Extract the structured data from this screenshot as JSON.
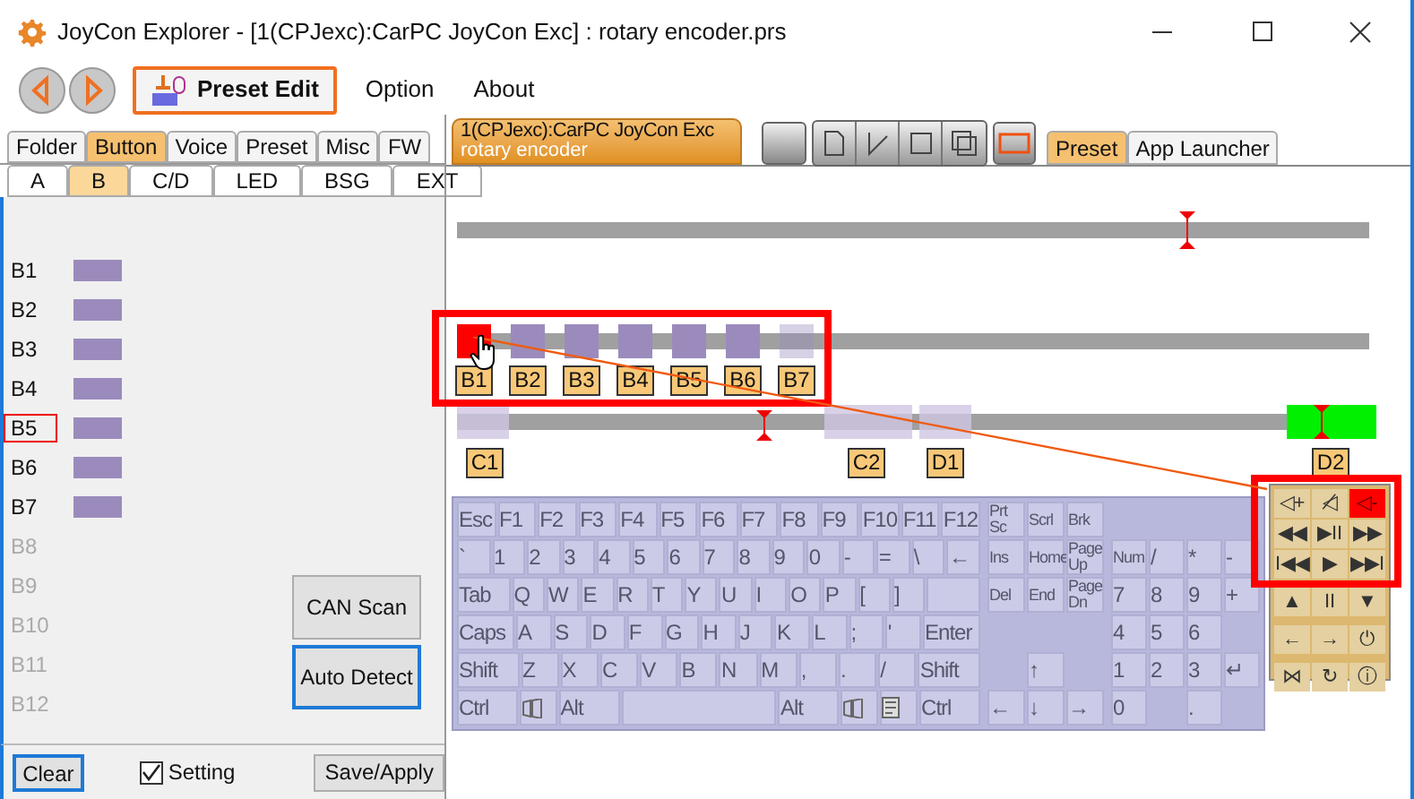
{
  "window": {
    "title": "JoyCon Explorer - [1(CPJexc):CarPC JoyCon Exc] : rotary encoder.prs"
  },
  "menu": [
    {
      "label": "Preset Edit",
      "selected": true
    },
    {
      "label": "Option",
      "selected": false
    },
    {
      "label": "About",
      "selected": false
    }
  ],
  "main_tabs": [
    {
      "label": "Folder",
      "selected": false
    },
    {
      "label": "Button",
      "selected": true
    },
    {
      "label": "Voice",
      "selected": false
    },
    {
      "label": "Preset",
      "selected": false
    },
    {
      "label": "Misc",
      "selected": false
    },
    {
      "label": "FW",
      "selected": false
    }
  ],
  "sub_tabs": [
    {
      "label": "A",
      "selected": false
    },
    {
      "label": "B",
      "selected": true
    },
    {
      "label": "C/D",
      "selected": false
    },
    {
      "label": "LED",
      "selected": false
    },
    {
      "label": "BSG",
      "selected": false
    },
    {
      "label": "EXT",
      "selected": false
    }
  ],
  "button_list": [
    {
      "label": "B1",
      "assigned": true,
      "selected": false
    },
    {
      "label": "B2",
      "assigned": true,
      "selected": false
    },
    {
      "label": "B3",
      "assigned": true,
      "selected": false
    },
    {
      "label": "B4",
      "assigned": true,
      "selected": false
    },
    {
      "label": "B5",
      "assigned": true,
      "selected": true
    },
    {
      "label": "B6",
      "assigned": true,
      "selected": false
    },
    {
      "label": "B7",
      "assigned": true,
      "selected": false
    },
    {
      "label": "B8",
      "assigned": false,
      "selected": false
    },
    {
      "label": "B9",
      "assigned": false,
      "selected": false
    },
    {
      "label": "B10",
      "assigned": false,
      "selected": false
    },
    {
      "label": "B11",
      "assigned": false,
      "selected": false
    },
    {
      "label": "B12",
      "assigned": false,
      "selected": false
    }
  ],
  "actions": [
    {
      "label": "CAN Scan",
      "focused": false
    },
    {
      "label": "Auto Detect",
      "focused": true
    }
  ],
  "footer": {
    "clear": {
      "label": "Clear",
      "focused": true
    },
    "setting": {
      "label": "Setting",
      "checked": true
    },
    "save": "Save/Apply"
  },
  "device_tab": {
    "title": "1(CPJexc):CarPC JoyCon Exc",
    "subtitle": "rotary encoder"
  },
  "panel_tabs": [
    {
      "label": "Preset",
      "selected": true
    },
    {
      "label": "App Launcher",
      "selected": false
    }
  ],
  "timeline": {
    "buttons": [
      {
        "label": "B1",
        "selected": true,
        "dimmed": false
      },
      {
        "label": "B2",
        "selected": false,
        "dimmed": false
      },
      {
        "label": "B3",
        "selected": false,
        "dimmed": false
      },
      {
        "label": "B4",
        "selected": false,
        "dimmed": false
      },
      {
        "label": "B5",
        "selected": false,
        "dimmed": false
      },
      {
        "label": "B6",
        "selected": false,
        "dimmed": false
      },
      {
        "label": "B7",
        "selected": false,
        "dimmed": true
      }
    ],
    "ranges": [
      {
        "label": "C1",
        "active": false
      },
      {
        "label": "C2",
        "active": false
      },
      {
        "label": "D1",
        "active": false
      },
      {
        "label": "D2",
        "active": true
      }
    ]
  },
  "keyboard": {
    "main": [
      [
        {
          "kind": "key",
          "label": "Esc"
        },
        {
          "kind": "key",
          "label": "F1"
        },
        {
          "kind": "key",
          "label": "F2"
        },
        {
          "kind": "key",
          "label": "F3"
        },
        {
          "kind": "key",
          "label": "F4"
        },
        {
          "kind": "key",
          "label": "F5"
        },
        {
          "kind": "key",
          "label": "F6"
        },
        {
          "kind": "key",
          "label": "F7"
        },
        {
          "kind": "key",
          "label": "F8"
        },
        {
          "kind": "key",
          "label": "F9"
        },
        {
          "kind": "key",
          "label": "F10"
        },
        {
          "kind": "key",
          "label": "F11"
        },
        {
          "kind": "key",
          "label": "F12"
        }
      ],
      [
        {
          "kind": "key",
          "label": "`"
        },
        {
          "kind": "key",
          "label": "1"
        },
        {
          "kind": "key",
          "label": "2"
        },
        {
          "kind": "key",
          "label": "3"
        },
        {
          "kind": "key",
          "label": "4"
        },
        {
          "kind": "key",
          "label": "5"
        },
        {
          "kind": "key",
          "label": "6"
        },
        {
          "kind": "key",
          "label": "7"
        },
        {
          "kind": "key",
          "label": "8"
        },
        {
          "kind": "key",
          "label": "9"
        },
        {
          "kind": "key",
          "label": "0"
        },
        {
          "kind": "key",
          "label": "-"
        },
        {
          "kind": "key",
          "label": "="
        },
        {
          "kind": "key",
          "label": "\\"
        },
        {
          "kind": "key",
          "label": "←"
        }
      ],
      [
        {
          "kind": "wide",
          "label": "Tab"
        },
        {
          "kind": "key",
          "label": "Q"
        },
        {
          "kind": "key",
          "label": "W"
        },
        {
          "kind": "key",
          "label": "E"
        },
        {
          "kind": "key",
          "label": "R"
        },
        {
          "kind": "key",
          "label": "T"
        },
        {
          "kind": "key",
          "label": "Y"
        },
        {
          "kind": "key",
          "label": "U"
        },
        {
          "kind": "key",
          "label": "I"
        },
        {
          "kind": "key",
          "label": "O"
        },
        {
          "kind": "key",
          "label": "P"
        },
        {
          "kind": "key",
          "label": "["
        },
        {
          "kind": "key",
          "label": "]"
        },
        {
          "kind": "blank"
        }
      ],
      [
        {
          "kind": "wide",
          "label": "Caps"
        },
        {
          "kind": "key",
          "label": "A"
        },
        {
          "kind": "key",
          "label": "S"
        },
        {
          "kind": "key",
          "label": "D"
        },
        {
          "kind": "key",
          "label": "F"
        },
        {
          "kind": "key",
          "label": "G"
        },
        {
          "kind": "key",
          "label": "H"
        },
        {
          "kind": "key",
          "label": "J"
        },
        {
          "kind": "key",
          "label": "K"
        },
        {
          "kind": "key",
          "label": "L"
        },
        {
          "kind": "key",
          "label": ";"
        },
        {
          "kind": "key",
          "label": "'"
        },
        {
          "kind": "wide",
          "label": "Enter"
        }
      ],
      [
        {
          "kind": "wide",
          "label": "Shift"
        },
        {
          "kind": "key",
          "label": "Z"
        },
        {
          "kind": "key",
          "label": "X"
        },
        {
          "kind": "key",
          "label": "C"
        },
        {
          "kind": "key",
          "label": "V"
        },
        {
          "kind": "key",
          "label": "B"
        },
        {
          "kind": "key",
          "label": "N"
        },
        {
          "kind": "key",
          "label": "M"
        },
        {
          "kind": "key",
          "label": ","
        },
        {
          "kind": "key",
          "label": "."
        },
        {
          "kind": "key",
          "label": "/"
        },
        {
          "kind": "wide",
          "label": "Shift"
        }
      ],
      [
        {
          "kind": "wide",
          "label": "Ctrl"
        },
        {
          "kind": "logo"
        },
        {
          "kind": "wide",
          "label": "Alt"
        },
        {
          "kind": "space"
        },
        {
          "kind": "wide",
          "label": "Alt"
        },
        {
          "kind": "logo"
        },
        {
          "kind": "menu"
        },
        {
          "kind": "wide",
          "label": "Ctrl"
        }
      ]
    ],
    "nav": [
      "Prt Sc",
      "Scrl",
      "Brk",
      "Ins",
      "Home",
      "Page Up",
      "Del",
      "End",
      "Page Dn",
      "↑",
      "←",
      "↓",
      "→"
    ],
    "numpad": [
      "Num",
      "/",
      "*",
      "-",
      "7",
      "8",
      "9",
      "+",
      "4",
      "5",
      "6",
      "1",
      "2",
      "3",
      "↵",
      "0",
      "."
    ]
  },
  "media_buttons": [
    {
      "label": "◁+",
      "selected": false
    },
    {
      "label": "◁̸",
      "selected": false
    },
    {
      "label": "◁-",
      "selected": true
    },
    {
      "label": "◀◀",
      "selected": false
    },
    {
      "label": "▶II",
      "selected": false
    },
    {
      "label": "▶▶",
      "selected": false
    },
    {
      "label": "I◀◀",
      "selected": false
    },
    {
      "label": "▶",
      "selected": false
    },
    {
      "label": "▶▶I",
      "selected": false
    },
    {
      "label": "▲",
      "selected": false
    },
    {
      "label": "II",
      "selected": false
    },
    {
      "label": "▼",
      "selected": false
    },
    {
      "label": "←",
      "selected": false
    },
    {
      "label": "→",
      "selected": false
    },
    {
      "label": "⏻",
      "selected": false
    },
    {
      "label": "⋈",
      "selected": false
    },
    {
      "label": "↻",
      "selected": false
    },
    {
      "label": "ⓘ",
      "selected": false
    }
  ]
}
